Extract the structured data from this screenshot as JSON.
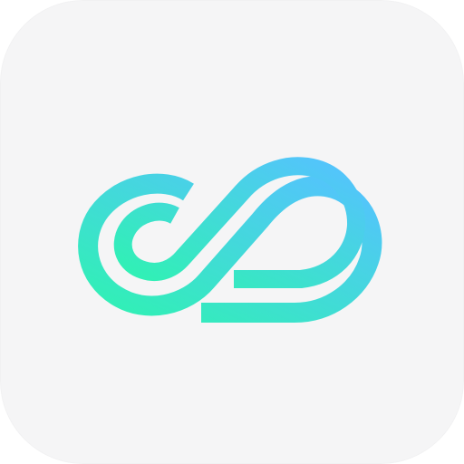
{
  "app_icon": {
    "icon": "cloud-infinity-logo-icon",
    "colors": {
      "tile_background": "#f5f5f6",
      "gradient_start": "#2ff2b2",
      "gradient_end": "#55c2ff"
    }
  }
}
